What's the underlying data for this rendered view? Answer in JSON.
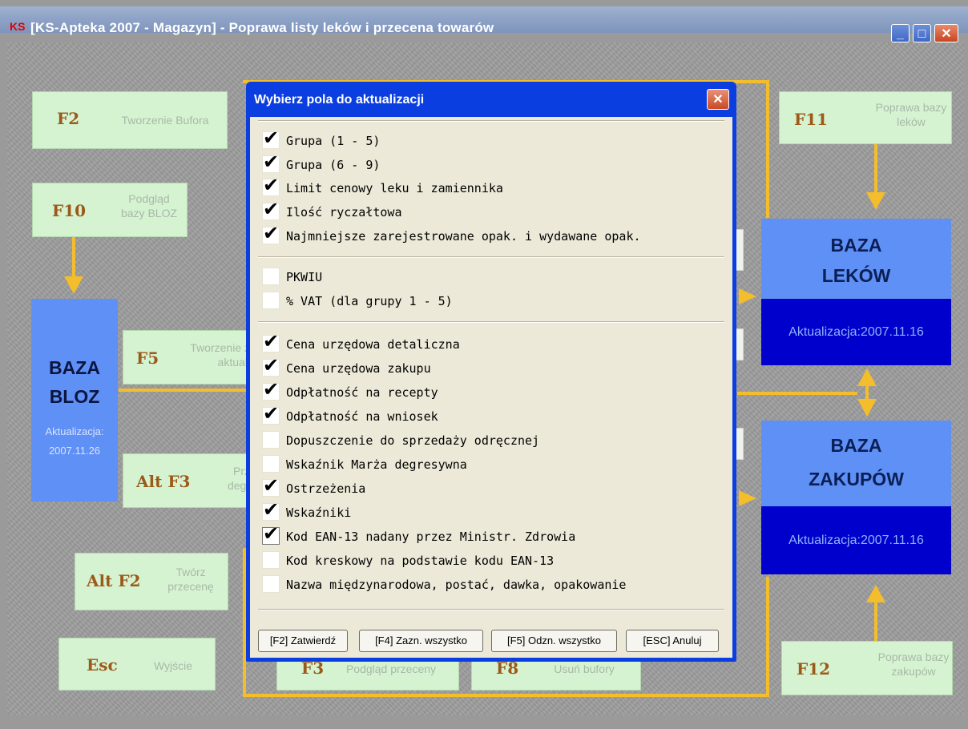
{
  "window": {
    "title": "[KS-Apteka 2007 - Magazyn] - Poprawa listy leków i przecena towarów",
    "app_icon": "KS",
    "min_label": "_",
    "max_label": "□",
    "close_label": "✕"
  },
  "fkeys": [
    {
      "key": "F2",
      "label": "Tworzenie Bufora"
    },
    {
      "key": "F10",
      "label": "Podgląd bazy BLOZ"
    },
    {
      "key": "F5",
      "label": "Tworzenie z aktuali"
    },
    {
      "key": "Alt F3",
      "label": "Prz degr"
    },
    {
      "key": "Alt F2",
      "label": "Twórz przecenę"
    },
    {
      "key": "Esc",
      "label": "Wyjście"
    },
    {
      "key": "F3",
      "label": "Podgląd przeceny"
    },
    {
      "key": "F8",
      "label": "Usuń bufory"
    },
    {
      "key": "F11",
      "label": "Poprawa bazy leków"
    },
    {
      "key": "F12",
      "label": "Poprawa bazy zakupów"
    }
  ],
  "bloz": {
    "name": "BAZA BLOZ",
    "line1": "BAZA",
    "line2": "BLOZ",
    "update_label": "Aktualizacja:",
    "update_date": "2007.11.26"
  },
  "leki": {
    "line1": "BAZA",
    "line2": "LEKÓW",
    "update": "Aktualizacja:2007.11.16"
  },
  "zakupy": {
    "line1": "BAZA",
    "line2": "ZAKUPÓW",
    "update": "Aktualizacja:2007.11.16"
  },
  "dialog": {
    "title": "Wybierz pola do aktualizacji",
    "close_label": "✕",
    "groups": [
      [
        {
          "label": "Grupa (1 - 5)",
          "checked": true
        },
        {
          "label": "Grupa (6 - 9)",
          "checked": true
        },
        {
          "label": "Limit cenowy leku i zamiennika",
          "checked": true
        },
        {
          "label": "Ilość ryczałtowa",
          "checked": true
        },
        {
          "label": "Najmniejsze zarejestrowane opak. i wydawane opak.",
          "checked": true
        }
      ],
      [
        {
          "label": "PKWIU",
          "checked": false
        },
        {
          "label": "% VAT (dla grupy 1 - 5)",
          "checked": false
        }
      ],
      [
        {
          "label": "Cena urzędowa detaliczna",
          "checked": true
        },
        {
          "label": "Cena urzędowa zakupu",
          "checked": true
        },
        {
          "label": "Odpłatność na recepty",
          "checked": true
        },
        {
          "label": "Odpłatność na wniosek",
          "checked": true
        },
        {
          "label": "Dopuszczenie do sprzedaży odręcznej",
          "checked": false
        },
        {
          "label": "Wskaźnik Marża degresywna",
          "checked": false
        },
        {
          "label": "Ostrzeżenia",
          "checked": true
        },
        {
          "label": "Wskaźniki",
          "checked": true
        },
        {
          "label": "Kod EAN-13 nadany przez Ministr. Zdrowia",
          "checked": true,
          "focused": true
        },
        {
          "label": "Kod kreskowy na podstawie kodu EAN-13",
          "checked": false
        },
        {
          "label": "Nazwa międzynarodowa, postać, dawka, opakowanie",
          "checked": false
        }
      ]
    ],
    "buttons": [
      {
        "label": "[F2] Zatwierdź"
      },
      {
        "label": "[F4] Zazn. wszystko"
      },
      {
        "label": "[F5] Odzn. wszystko"
      },
      {
        "label": "[ESC] Anuluj"
      }
    ]
  },
  "colors": {
    "accent": "#f3bd2c",
    "panel": "#d5f3d1",
    "database": "#5f90f5",
    "database_dark": "#0000cc",
    "key_text": "#9b5a1a"
  }
}
